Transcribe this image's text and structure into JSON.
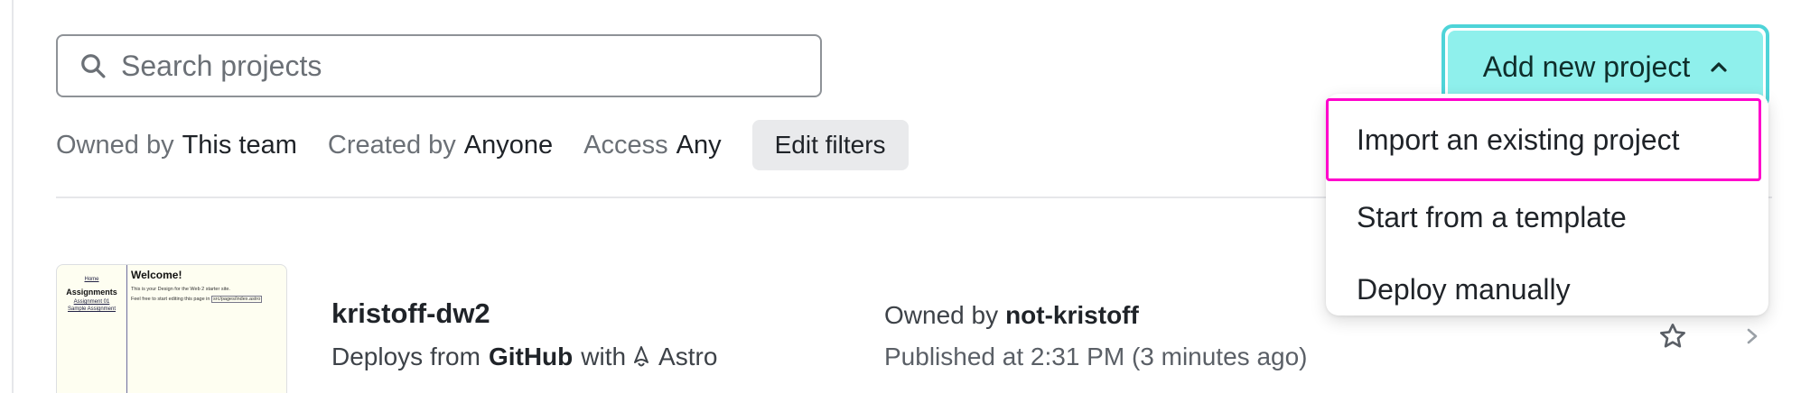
{
  "search": {
    "placeholder": "Search projects",
    "value": ""
  },
  "filters": [
    {
      "label": "Owned by",
      "value": "This team"
    },
    {
      "label": "Created by",
      "value": "Anyone"
    },
    {
      "label": "Access",
      "value": "Any"
    }
  ],
  "edit_filters_label": "Edit filters",
  "add_project": {
    "label": "Add new project",
    "menu": [
      "Import an existing project",
      "Start from a template",
      "Deploy manually"
    ]
  },
  "project": {
    "name": "kristoff-dw2",
    "deploy_prefix": "Deploys from",
    "provider": "GitHub",
    "with": "with",
    "framework": "Astro",
    "owner_label": "Owned by",
    "owner": "not-kristoff",
    "published": "Published at 2:31 PM (3 minutes ago)",
    "thumbnail": {
      "nav": [
        "Home"
      ],
      "nav_heading": "Assignments",
      "nav_items": [
        "Assignment 01",
        "Sample Assignment"
      ],
      "title": "Welcome!",
      "line1": "This is your Design for the Web 2 starter site.",
      "line2": "Feel free to start editing this page in",
      "code": "src/pages/index.astro"
    }
  },
  "colors": {
    "accent": "#8ff0ec",
    "accent_border": "#4ed4d8",
    "highlight": "#ff00cc"
  },
  "icons": [
    "search-icon",
    "chevron-up-icon",
    "astro-icon",
    "star-icon",
    "chevron-right-icon"
  ]
}
